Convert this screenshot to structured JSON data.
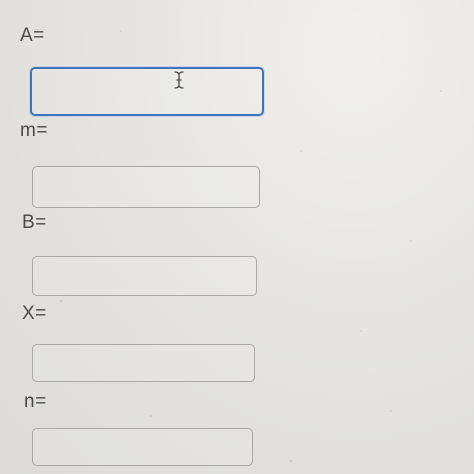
{
  "form": {
    "fields": [
      {
        "label": "A=",
        "value": "",
        "placeholder": ""
      },
      {
        "label": "m=",
        "value": "",
        "placeholder": ""
      },
      {
        "label": "B=",
        "value": "",
        "placeholder": ""
      },
      {
        "label": "X=",
        "value": "",
        "placeholder": ""
      },
      {
        "label": "n=",
        "value": "",
        "placeholder": ""
      }
    ]
  },
  "colors": {
    "focus_border": "#3f72c4",
    "field_border": "#a9a8a4",
    "background": "#e6e5e1"
  },
  "icons": {
    "pointer": "text-cursor-ibeam-icon"
  }
}
